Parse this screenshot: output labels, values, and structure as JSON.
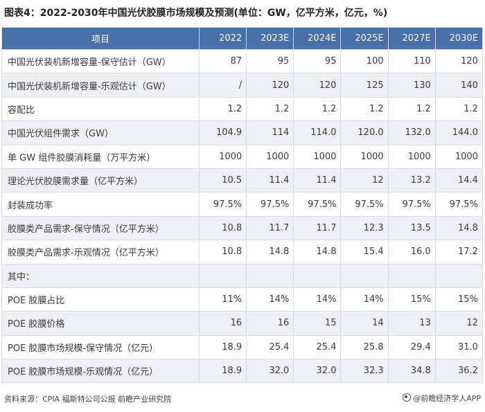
{
  "title": "图表4：2022-2030年中国光伏胶膜市场规模及预测(单位：GW，亿平方米，亿元，%)",
  "table": {
    "header": [
      "项目",
      "2022",
      "2023E",
      "2024E",
      "2025E",
      "2027E",
      "2030E"
    ],
    "rows": [
      [
        "中国光伏装机新增容量-保守估计（GW）",
        "87",
        "95",
        "95",
        "100",
        "110",
        "120"
      ],
      [
        "中国光伏装机新增容量-乐观估计（GW）",
        "/",
        "120",
        "120",
        "125",
        "130",
        "140"
      ],
      [
        "容配比",
        "1.2",
        "1.2",
        "1.2",
        "1.2",
        "1.2",
        "1.2"
      ],
      [
        "中国光伏组件需求（GW）",
        "104.9",
        "114",
        "114.0",
        "120.0",
        "132.0",
        "144.0"
      ],
      [
        "单 GW 组件胶膜消耗量（万平方米）",
        "1000",
        "1000",
        "1000",
        "1000",
        "1000",
        "1000"
      ],
      [
        "理论光伏胶膜需求量（亿平方米）",
        "10.5",
        "11.4",
        "11.4",
        "12",
        "13.2",
        "14.4"
      ],
      [
        "封装成功率",
        "97.5%",
        "97.5%",
        "97.5%",
        "97.5%",
        "97.5%",
        "97.5%"
      ],
      [
        "胶膜类产品需求-保守情况（亿平方米）",
        "10.8",
        "11.7",
        "11.7",
        "12.3",
        "13.5",
        "14.8"
      ],
      [
        "胶膜类产品需求-乐观情况（亿平方米）",
        "10.8",
        "14.8",
        "14.8",
        "15.4",
        "16.0",
        "17.2"
      ],
      [
        "其中：",
        "",
        "",
        "",
        "",
        "",
        ""
      ],
      [
        "POE 胶膜占比",
        "11%",
        "14%",
        "14%",
        "14%",
        "15%",
        "15%"
      ],
      [
        "POE 胶膜价格",
        "16",
        "16",
        "15",
        "14",
        "13",
        "12"
      ],
      [
        "POE 胶膜市场规模-保守情况（亿元）",
        "18.9",
        "25.4",
        "25.4",
        "25.8",
        "29.4",
        "31.0"
      ],
      [
        "POE 胶膜市场规模-乐观情况（亿元）",
        "18.9",
        "32.0",
        "32.0",
        "32.3",
        "34.8",
        "36.2"
      ]
    ]
  },
  "footer": {
    "source": "资料来源：CPIA 福斯特公司公报 前瞻产业研究院",
    "brand": "@前瞻经济学人APP"
  },
  "colors": {
    "header_bg": "#4a6ea8",
    "alt_row_bg": "#eef0f5",
    "border": "#d9dce3"
  }
}
